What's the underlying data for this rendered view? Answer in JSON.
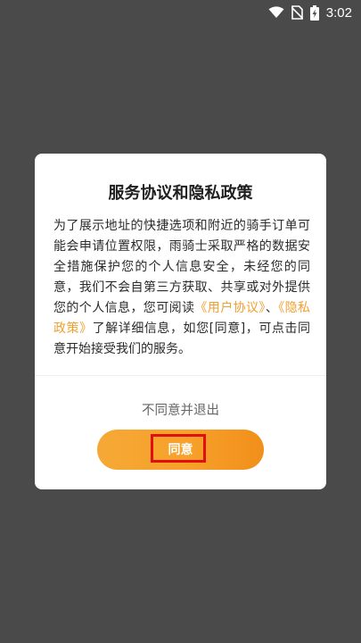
{
  "status_bar": {
    "time": "3:02",
    "icons": [
      "wifi-icon",
      "no-sim-icon",
      "battery-charging-icon"
    ]
  },
  "dialog": {
    "title": "服务协议和隐私政策",
    "body_parts": {
      "before": "为了展示地址的快捷选项和附近的骑手订单可能会申请位置权限，雨骑士采取严格的数据安全措施保护您的个人信息安全，未经您的同意，我们不会自第三方获取、共享或对外提供您的个人信息，您可阅读",
      "user_agreement_link": "《用户协议》",
      "separator": "、",
      "privacy_policy_link": "《隐私政策》",
      "after": "了解详细信息，如您[同意]，可点击同意开始接受我们的服务。"
    },
    "decline_label": "不同意并退出",
    "agree_label": "同意"
  },
  "colors": {
    "overlay": "#4a4a4a",
    "link": "#f0a030",
    "button_gradient_start": "#f5a836",
    "button_gradient_end": "#f18f1b",
    "highlight_box": "#e01010"
  }
}
